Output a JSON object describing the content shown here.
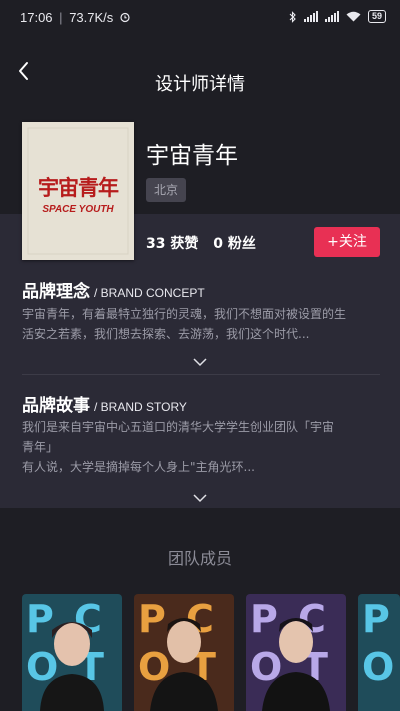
{
  "status_bar": {
    "time": "17:06",
    "speed": "73.7K/s",
    "battery": "59"
  },
  "nav": {
    "title": "设计师详情"
  },
  "designer": {
    "name": "宇宙青年",
    "location": "北京",
    "likes": "33 获赞",
    "fans": "0 粉丝",
    "follow_label": "+关注",
    "cover": {
      "title_cn": "宇宙青年",
      "title_en": "SPACE YOUTH"
    }
  },
  "brand_concept": {
    "title": "品牌理念",
    "subtitle": "/ BRAND CONCEPT",
    "lines": [
      "宇宙青年，有着最特立独行的灵魂，我们不想面对被设置的生",
      "活安之若素，我们想去探索、去游荡，我们这个时代..."
    ]
  },
  "brand_story": {
    "title": "品牌故事",
    "subtitle": "/ BRAND STORY",
    "lines": [
      "我们是来自宇宙中心五道口的清华大学学生创业团队「宇宙",
      "青年」",
      "有人说，大学是摘掉每个人身上\"主角光环..."
    ]
  },
  "team": {
    "title": "团队成员"
  },
  "colors": {
    "accent": "#e83054",
    "bg": "#1e1e24",
    "panel": "#2b2a36"
  },
  "icons": [
    "back-icon",
    "chevron-down-icon",
    "bluetooth-icon",
    "wifi-icon",
    "alarm-icon"
  ]
}
